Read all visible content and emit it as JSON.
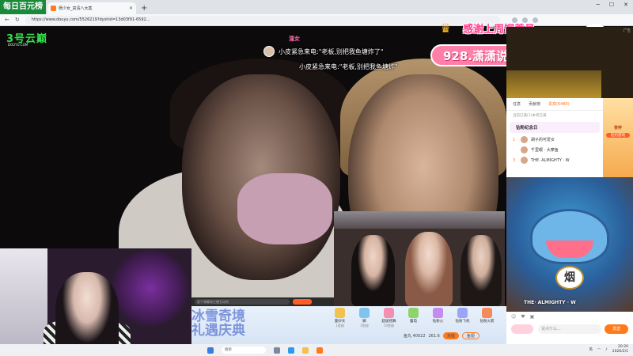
{
  "overlay": {
    "rank_badge": "每日百元榜"
  },
  "browser": {
    "tab_title": "杨少女_高清八大案",
    "new_tab": "+",
    "url": "https://www.douyu.com/5526219?dyshid=13d03f91-6592..."
  },
  "stream": {
    "logo": "3号云巅",
    "logo_sub": "DOUYU.COM"
  },
  "danmu": {
    "sender": "潼女",
    "line1": "小皮紧急来电:\"老板,别把我鱼塘炸了\"",
    "line2": "小皮紧急来电:\"老板,别把我鱼塘炸\""
  },
  "banner": {
    "headline": "感谢上周饲养员",
    "name": "928.潇潇说的都可"
  },
  "player": {
    "input_placeholder": "发个弹幕和主播互动吧"
  },
  "gift_panel": {
    "banner_text": "冰雪奇境 礼遇庆典",
    "gifts": [
      {
        "name": "曼妙天",
        "price": "1鱼翅"
      },
      {
        "name": "鳞",
        "price": "1鱼翅"
      },
      {
        "name": "超级摇舞",
        "price": "10鱼翅"
      },
      {
        "name": "露电",
        "price": ""
      },
      {
        "name": "钻粉火",
        "price": ""
      },
      {
        "name": "钻粉飞机",
        "price": ""
      },
      {
        "name": "钻粉火箭",
        "price": ""
      }
    ],
    "wallet_fish": "鱼丸 40022",
    "wallet_coin": "261.6",
    "recharge_label": "充值",
    "fill_label": "鱼翅"
  },
  "sidebar": {
    "ad_label": "广告",
    "tabs": [
      "任意",
      "贡献榜",
      "贵宾(6480)"
    ],
    "hint": "当前已满(1)本周已满",
    "list_title": "钻粉纪念日",
    "ranks": [
      {
        "num": "1",
        "name": "胡子的可爱女"
      },
      {
        "name": "千里眼 · 大摩鱼"
      },
      {
        "num": "3",
        "name": "THE· ALMIGHTY · W"
      }
    ],
    "promo_title": "茶杯",
    "promo_sub": "赴约游戏"
  },
  "game": {
    "token": "烟",
    "user": "THE· ALMIGHTY · W"
  },
  "chat": {
    "input_placeholder": "说点什么...",
    "send_label": "发送"
  },
  "taskbar": {
    "search": "搜索",
    "tray_lang": "英",
    "time": "20:20",
    "date": "2026/2/1"
  }
}
